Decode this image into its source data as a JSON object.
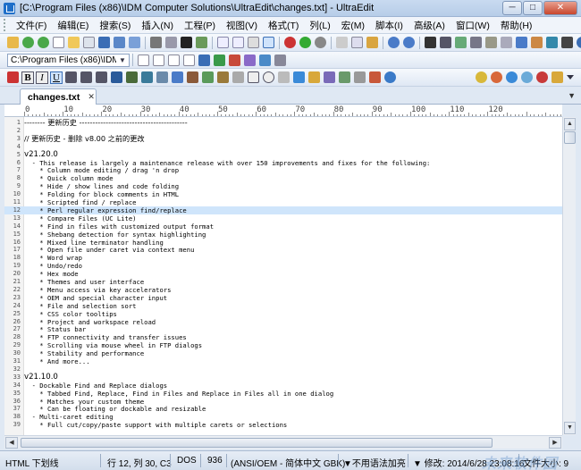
{
  "window": {
    "title": "[C:\\Program Files (x86)\\IDM Computer Solutions\\UltraEdit\\changes.txt] - UltraEdit",
    "minimize": "─",
    "maximize": "□",
    "close": "✕"
  },
  "menu": [
    {
      "label": "文件(F)"
    },
    {
      "label": "编辑(E)"
    },
    {
      "label": "搜索(S)"
    },
    {
      "label": "插入(N)"
    },
    {
      "label": "工程(P)"
    },
    {
      "label": "视图(V)"
    },
    {
      "label": "格式(T)"
    },
    {
      "label": "列(L)"
    },
    {
      "label": "宏(M)"
    },
    {
      "label": "脚本(I)"
    },
    {
      "label": "高级(A)"
    },
    {
      "label": "窗口(W)"
    },
    {
      "label": "帮助(H)"
    }
  ],
  "toolbar": {
    "path": "C:\\Program Files (x86)\\IDM Co",
    "format_buttons": {
      "bold": "B",
      "italic": "I",
      "underline": "U"
    }
  },
  "tab": {
    "label": "changes.txt",
    "close": "✕",
    "dropdown": "▼"
  },
  "ruler": {
    "marks": [
      "0",
      "10",
      "20",
      "30",
      "40",
      "50",
      "60",
      "70",
      "80",
      "90",
      "100",
      "110",
      "120"
    ]
  },
  "editor": {
    "highlight_line": 12,
    "lines": [
      {
        "n": "1",
        "t": "-------- 更新历史 -----------------------------------------"
      },
      {
        "n": "2",
        "t": ""
      },
      {
        "n": "3",
        "t": "// 更新历史 - 删除 v8.00 之前的更改"
      },
      {
        "n": "4",
        "t": ""
      },
      {
        "n": "5",
        "t": "v21.20.0"
      },
      {
        "n": "6",
        "t": "  - This release is largely a maintenance release with over 150 improvements and fixes for the following:"
      },
      {
        "n": "7",
        "t": "    * Column mode editing / drag 'n drop"
      },
      {
        "n": "8",
        "t": "    * Quick column mode"
      },
      {
        "n": "9",
        "t": "    * Hide / show lines and code folding"
      },
      {
        "n": "10",
        "t": "    * Folding for block comments in HTML"
      },
      {
        "n": "11",
        "t": "    * Scripted find / replace"
      },
      {
        "n": "12",
        "t": "    * Perl regular expression find/replace"
      },
      {
        "n": "13",
        "t": "    * Compare Files (UC Lite)"
      },
      {
        "n": "14",
        "t": "    * Find in files with customized output format"
      },
      {
        "n": "15",
        "t": "    * Shebang detection for syntax highlighting"
      },
      {
        "n": "16",
        "t": "    * Mixed line terminator handling"
      },
      {
        "n": "17",
        "t": "    * Open file under caret via context menu"
      },
      {
        "n": "18",
        "t": "    * Word wrap"
      },
      {
        "n": "19",
        "t": "    * Undo/redo"
      },
      {
        "n": "20",
        "t": "    * Hex mode"
      },
      {
        "n": "21",
        "t": "    * Themes and user interface"
      },
      {
        "n": "22",
        "t": "    * Menu access via key accelerators"
      },
      {
        "n": "23",
        "t": "    * OEM and special character input"
      },
      {
        "n": "24",
        "t": "    * File and selection sort"
      },
      {
        "n": "25",
        "t": "    * CSS color tooltips"
      },
      {
        "n": "26",
        "t": "    * Project and workspace reload"
      },
      {
        "n": "27",
        "t": "    * Status bar"
      },
      {
        "n": "28",
        "t": "    * FTP connectivity and transfer issues"
      },
      {
        "n": "29",
        "t": "    * Scrolling via mouse wheel in FTP dialogs"
      },
      {
        "n": "30",
        "t": "    * Stability and performance"
      },
      {
        "n": "31",
        "t": "    * And more..."
      },
      {
        "n": "32",
        "t": ""
      },
      {
        "n": "33",
        "t": "v21.10.0"
      },
      {
        "n": "34",
        "t": "  - Dockable Find and Replace dialogs"
      },
      {
        "n": "35",
        "t": "    * Tabbed Find, Replace, Find in Files and Replace in Files all in one dialog"
      },
      {
        "n": "36",
        "t": "    * Matches your custom theme"
      },
      {
        "n": "37",
        "t": "    * Can be floating or dockable and resizable"
      },
      {
        "n": "38",
        "t": "  - Multi-caret editing"
      },
      {
        "n": "39",
        "t": "    * Full cut/copy/paste support with multiple carets or selections"
      }
    ]
  },
  "statusbar": {
    "mode": "HTML 下划线",
    "position": "行 12, 列 30, C3",
    "line_ending": "DOS",
    "codepage": "936",
    "encoding": "(ANSI/OEM - 简体中文 GBK)",
    "syntax": "▼不用语法加亮",
    "modified": "▼ 修改: 2014/6/28 23:08:16",
    "filesize": "文件大小: 9",
    "watermark": "未来软件园"
  },
  "colors": {
    "highlight": "#cfe5fb",
    "accent": "#1f6fc9",
    "chrome": "#dfe8f3"
  }
}
